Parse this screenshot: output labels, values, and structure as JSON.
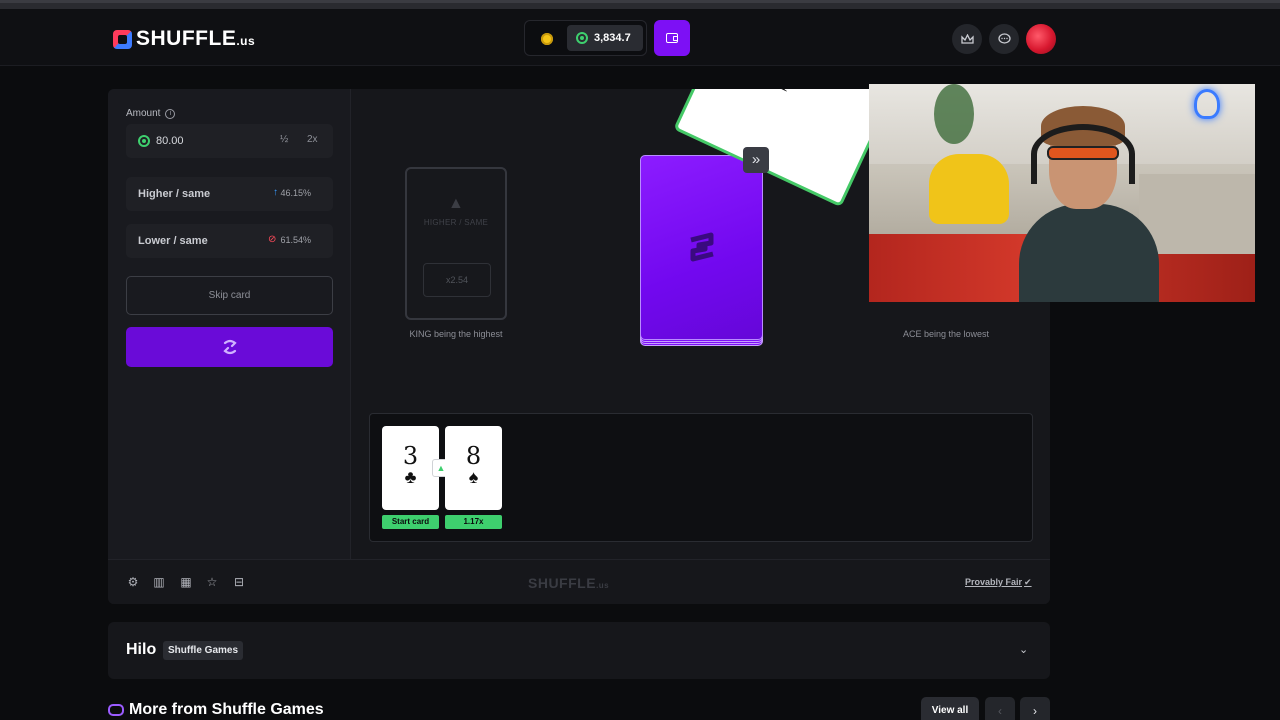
{
  "header": {
    "logo_text": "SHUFFLE",
    "logo_tld": ".us",
    "balance": "3,834.7",
    "icons": [
      "crown-icon",
      "chat-icon"
    ]
  },
  "sidebar": {
    "amount_label": "Amount",
    "amount_value": "80.00",
    "half_label": "½",
    "double_label": "2x",
    "higher_label": "Higher / same",
    "higher_pct": "46.15%",
    "lower_label": "Lower / same",
    "lower_pct": "61.54%",
    "skip_label": "Skip card"
  },
  "stage": {
    "ghost_text": "HIGHER / SAME",
    "ghost_multiplier": "x2.54",
    "caption_left": "KING being the highest",
    "caption_right": "ACE being the lowest",
    "fast_forward": "»"
  },
  "history": {
    "cards": [
      {
        "rank": "3",
        "suit": "♣",
        "tag": "Start card"
      },
      {
        "rank": "8",
        "suit": "♠",
        "tag": "1.17x"
      }
    ],
    "direction": "▲"
  },
  "footer": {
    "logo_text": "SHUFFLE",
    "logo_tld": ".us",
    "provably_fair": "Provably Fair"
  },
  "game_info": {
    "title": "Hilo",
    "badge": "Shuffle Games"
  },
  "more": {
    "title": "More from Shuffle Games",
    "view_all": "View all"
  },
  "colors": {
    "accent_purple": "#7d10f5",
    "success_green": "#3ecf6e",
    "background": "#0b0c0e"
  }
}
